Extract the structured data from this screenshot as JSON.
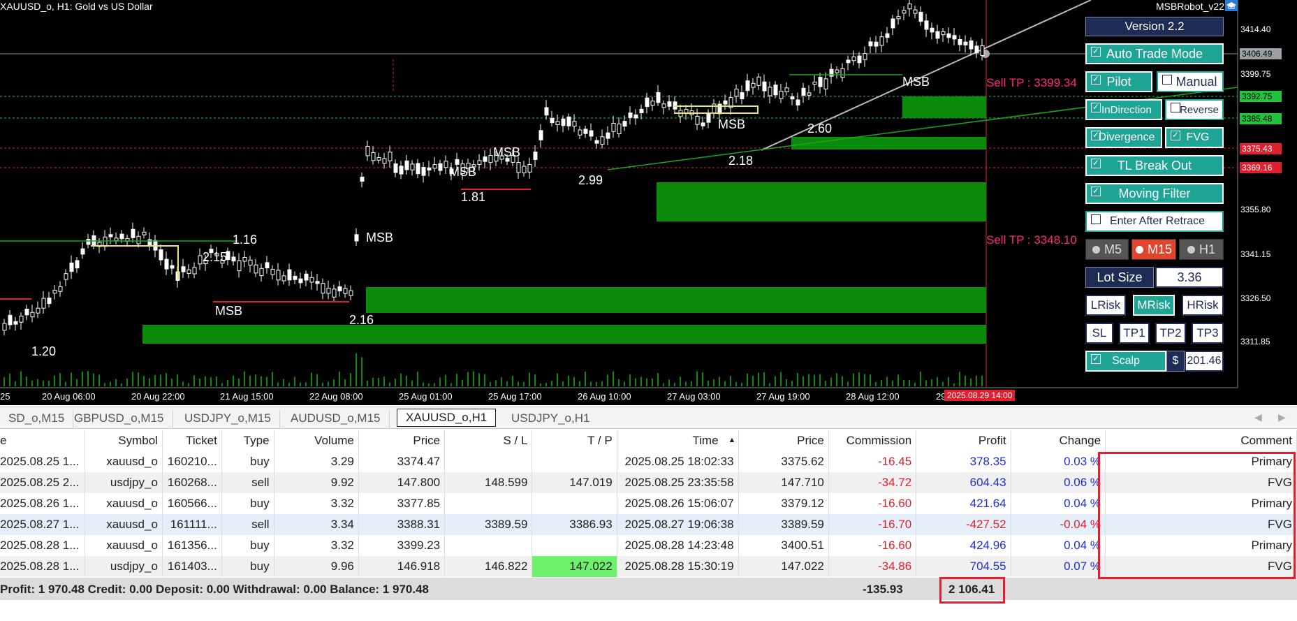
{
  "chart": {
    "title": "XAUUSD_o, H1:  Gold vs US Dollar",
    "ea_name": "MSBRobot_v22",
    "price_labels": [
      "3414.40",
      "3399.75",
      "3355.80",
      "3341.15",
      "3326.50",
      "3311.85"
    ],
    "price_boxes": [
      {
        "text": "3406.49",
        "bg": "#9aa0a6",
        "fg": "#000"
      },
      {
        "text": "3392.75",
        "bg": "#23c23c",
        "fg": "#000"
      },
      {
        "text": "3385.48",
        "bg": "#23c23c",
        "fg": "#000"
      },
      {
        "text": "3375.43",
        "bg": "#e0202f",
        "fg": "#fff"
      },
      {
        "text": "3369.16",
        "bg": "#e0202f",
        "fg": "#fff"
      }
    ],
    "time_labels": [
      "25",
      "20 Aug 06:00",
      "20 Aug 22:00",
      "21 Aug 15:00",
      "22 Aug 08:00",
      "25 Aug 01:00",
      "25 Aug 17:00",
      "26 Aug 10:00",
      "27 Aug 03:00",
      "27 Aug 19:00",
      "28 Aug 12:00",
      "29"
    ],
    "current_time": "2025.08.29 14:00",
    "annotations": [
      "1.20",
      "2.15",
      "1.16",
      "MSB",
      "MSB",
      "2.16",
      "MSB",
      "1.81",
      "MSB",
      "2.99",
      "MSB",
      "2.18",
      "2.60",
      "MSB"
    ],
    "sell_tp_1": "Sell TP : 3399.34",
    "sell_tp_2": "Sell TP : 3348.10"
  },
  "panel": {
    "version": "Version 2.2",
    "auto_trade": "Auto Trade Mode",
    "pilot": "Pilot",
    "manual": "Manual",
    "indirection": "InDirection",
    "reverse": "Reverse",
    "divergence": "Divergence",
    "fvg": "FVG",
    "tl_breakout": "TL Break Out",
    "moving_filter": "Moving Filter",
    "enter_after_retrace": "Enter After Retrace",
    "tf_m5": "M5",
    "tf_m15": "M15",
    "tf_h1": "H1",
    "lot_size_label": "Lot Size",
    "lot_size_value": "3.36",
    "lrisk": "LRisk",
    "mrisk": "MRisk",
    "hrisk": "HRisk",
    "sl": "SL",
    "tp1": "TP1",
    "tp2": "TP2",
    "tp3": "TP3",
    "scalp": "Scalp",
    "dollar": "$",
    "scalp_value": "201.46"
  },
  "tabs": [
    "SD_o,M15",
    "GBPUSD_o,M15",
    "USDJPY_o,M15",
    "AUDUSD_o,M15",
    "XAUUSD_o,H1",
    "USDJPY_o,H1"
  ],
  "active_tab": "XAUUSD_o,H1",
  "columns": [
    "e",
    "Symbol",
    "Ticket",
    "Type",
    "Volume",
    "Price",
    "S / L",
    "T / P",
    "Time",
    "Price",
    "Commission",
    "Profit",
    "Change",
    "Comment"
  ],
  "rows": [
    [
      "2025.08.25 1...",
      "xauusd_o",
      "160210...",
      "buy",
      "3.29",
      "3374.47",
      "",
      "",
      "2025.08.25 18:02:33",
      "3375.62",
      "-16.45",
      "378.35",
      "0.03 %",
      "Primary"
    ],
    [
      "2025.08.25 2...",
      "usdjpy_o",
      "160268...",
      "sell",
      "9.92",
      "147.800",
      "148.599",
      "147.019",
      "2025.08.25 23:35:58",
      "147.710",
      "-34.72",
      "604.43",
      "0.06 %",
      "FVG"
    ],
    [
      "2025.08.26 1...",
      "xauusd_o",
      "160566...",
      "buy",
      "3.32",
      "3377.85",
      "",
      "",
      "2025.08.26 15:06:07",
      "3379.12",
      "-16.60",
      "421.64",
      "0.04 %",
      "Primary"
    ],
    [
      "2025.08.27 1...",
      "xauusd_o",
      "161111...",
      "sell",
      "3.34",
      "3388.31",
      "3389.59",
      "3386.93",
      "2025.08.27 19:06:38",
      "3389.59",
      "-16.70",
      "-427.52",
      "-0.04 %",
      "FVG"
    ],
    [
      "2025.08.28 1...",
      "xauusd_o",
      "161356...",
      "buy",
      "3.32",
      "3399.23",
      "",
      "",
      "2025.08.28 14:23:48",
      "3400.51",
      "-16.60",
      "424.96",
      "0.04 %",
      "Primary"
    ],
    [
      "2025.08.28 1...",
      "usdjpy_o",
      "161403...",
      "buy",
      "9.96",
      "146.918",
      "146.822",
      "147.022",
      "2025.08.28 15:30:19",
      "147.022",
      "-34.86",
      "704.55",
      "0.07 %",
      "FVG"
    ]
  ],
  "summary": {
    "text": "Profit: 1 970.48  Credit: 0.00  Deposit: 0.00  Withdrawal: 0.00  Balance: 1 970.48",
    "commission": "-135.93",
    "profit": "2 106.41"
  }
}
